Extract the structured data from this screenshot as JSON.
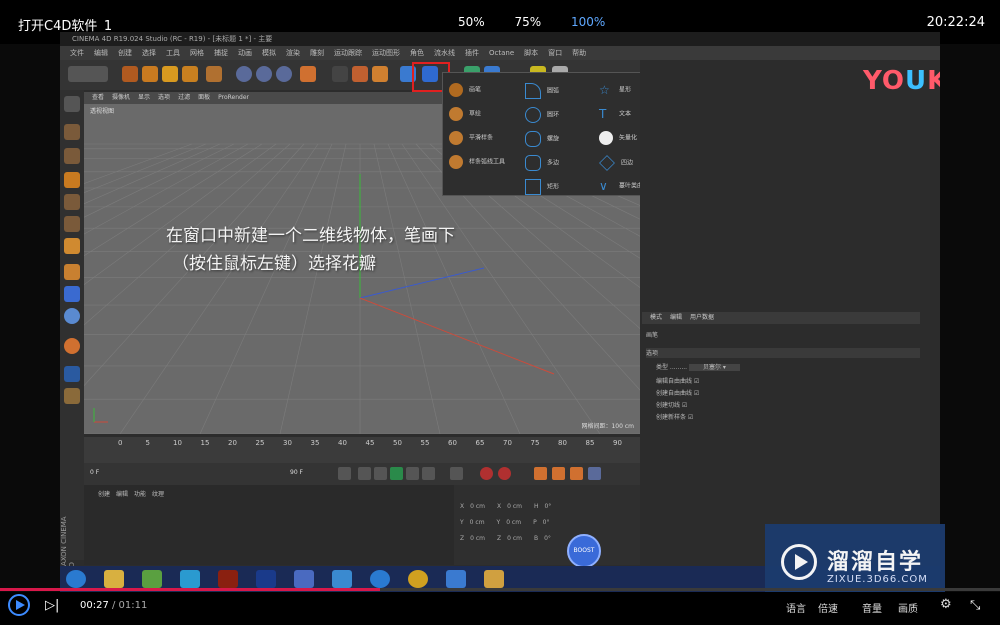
{
  "topbar": {
    "title": "打开C4D软件_1",
    "zoom_options": [
      "50%",
      "75%",
      "100%"
    ],
    "active_zoom": "100%",
    "clock": "20:22:24"
  },
  "c4d": {
    "window_title": "CINEMA 4D R19.024 Studio (RC - R19) - [未标题 1 *] - 主要",
    "overlay_line1": "在窗口中新建一个二维线物体，笔画下",
    "overlay_line2": "（按住鼠标左键）选择花瓣",
    "viewport_tab": "ProRender",
    "timeline_numbers": [
      "0",
      "5",
      "10",
      "15",
      "20",
      "25",
      "30",
      "35",
      "40",
      "45",
      "50",
      "55",
      "60",
      "65",
      "70",
      "75",
      "80",
      "85",
      "90"
    ],
    "frame_start": "0 F",
    "frame_end": "90 F",
    "brand_vertical": "MAXON CINEMA 4D",
    "blue_button": "BOOST",
    "youku_logo_a": "YO",
    "youku_logo_b": "U",
    "youku_logo_c": "KU"
  },
  "watermark": {
    "name": "溜溜自学",
    "url": "ZIXUE.3D66.COM"
  },
  "player": {
    "current_time": "00:27",
    "total_time": " / 01:11",
    "progress_fraction": 0.38,
    "right_controls": [
      "语言",
      "倍速",
      "音量",
      "画质"
    ]
  },
  "colors": {
    "progress": "#d8184a",
    "accent": "#3d8bff",
    "highlight_box": "#e02020"
  }
}
